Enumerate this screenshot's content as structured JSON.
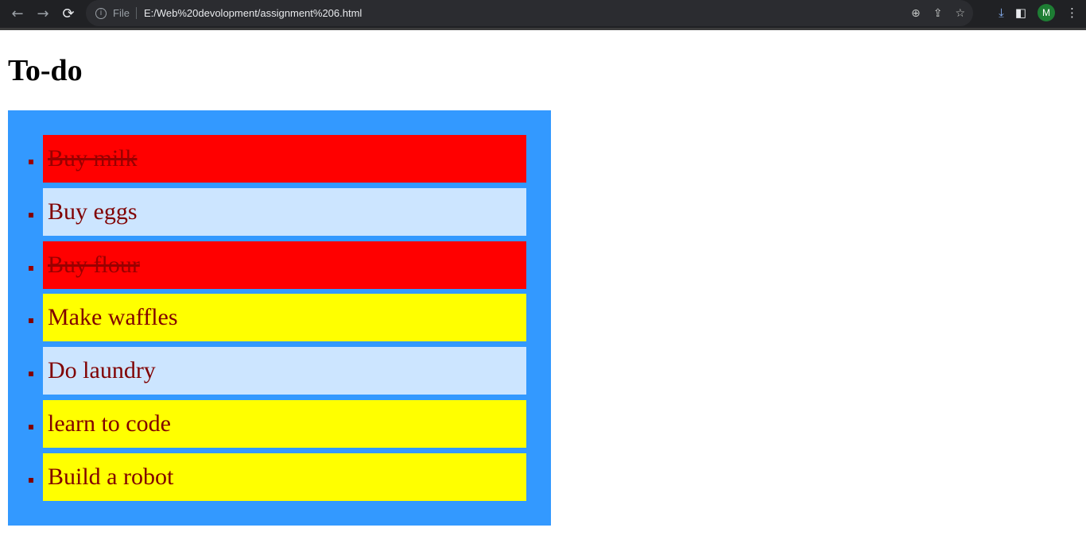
{
  "browser": {
    "file_label": "File",
    "url": "E:/Web%20devolopment/assignment%206.html",
    "profile_initial": "M"
  },
  "page": {
    "title": "To-do",
    "items": [
      {
        "label": "Buy milk",
        "state": "done"
      },
      {
        "label": "Buy eggs",
        "state": "pending"
      },
      {
        "label": "Buy flour",
        "state": "done"
      },
      {
        "label": "Make waffles",
        "state": "hi"
      },
      {
        "label": "Do laundry",
        "state": "pending"
      },
      {
        "label": "learn to code",
        "state": "hi"
      },
      {
        "label": "Build a robot",
        "state": "hi"
      }
    ]
  },
  "colors": {
    "list_bg": "#3399ff",
    "done": "#ff0000",
    "pending": "#cce5ff",
    "highlight": "#ffff00",
    "text": "#800000"
  }
}
